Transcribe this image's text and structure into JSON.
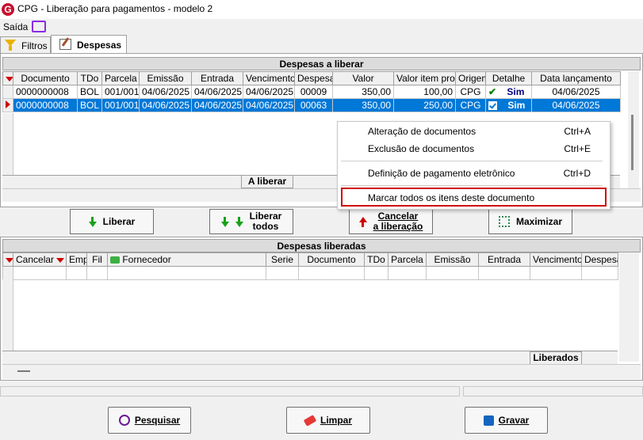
{
  "window": {
    "title": "CPG - Liberação para pagamentos - modelo 2",
    "logo_letter": "G"
  },
  "menu": {
    "saida": "Saída"
  },
  "tabs": [
    {
      "label": "Filtros"
    },
    {
      "label": "Despesas"
    }
  ],
  "top_grid": {
    "title": "Despesas a liberar",
    "columns": [
      "Documento",
      "TDo",
      "Parcela",
      "Emissão",
      "Entrada",
      "Vencimento",
      "Despesa",
      "Valor",
      "Valor item prop",
      "Origem",
      "Detalhe",
      "Data lançamento"
    ],
    "rows": [
      {
        "documento": "0000000008",
        "tdo": "BOL",
        "parcela": "001/001",
        "emissao": "04/06/2025",
        "entrada": "04/06/2025",
        "vencimento": "04/06/2025",
        "despesa": "00009",
        "valor": "350,00",
        "valor_item_prop": "100,00",
        "origem": "CPG",
        "detalhe": "Sim",
        "data_lancamento": "04/06/2025"
      },
      {
        "documento": "0000000008",
        "tdo": "BOL",
        "parcela": "001/001",
        "emissao": "04/06/2025",
        "entrada": "04/06/2025",
        "vencimento": "04/06/2025",
        "despesa": "00063",
        "valor": "350,00",
        "valor_item_prop": "250,00",
        "origem": "CPG",
        "detalhe": "Sim",
        "data_lancamento": "04/06/2025"
      }
    ],
    "footer_label": "A liberar"
  },
  "actions": {
    "liberar": "Liberar",
    "liberar_todos_1": "Liberar",
    "liberar_todos_2": "todos",
    "cancelar_1": "Cancelar",
    "cancelar_2": "a liberação",
    "maximizar": "Maximizar"
  },
  "bottom_grid": {
    "title": "Despesas liberadas",
    "columns": [
      "Cancelar",
      "Emp",
      "Fil",
      "Fornecedor",
      "Serie",
      "Documento",
      "TDo",
      "Parcela",
      "Emissão",
      "Entrada",
      "Vencimento",
      "Despesa"
    ],
    "footer_label": "Liberados"
  },
  "context_menu": {
    "items": [
      {
        "label": "Alteração de documentos",
        "shortcut": "Ctrl+A"
      },
      {
        "label": "Exclusão de documentos",
        "shortcut": "Ctrl+E"
      },
      {
        "label": "Definição de pagamento eletrônico",
        "shortcut": "Ctrl+D"
      },
      {
        "label": "Marcar todos os itens deste documento",
        "shortcut": ""
      }
    ]
  },
  "bottom_buttons": {
    "pesquisar": "Pesquisar",
    "limpar": "Limpar",
    "gravar": "Gravar"
  },
  "colors": {
    "selection": "#0078d7",
    "highlight_border": "#d00000",
    "accent_red": "#c8102e"
  }
}
